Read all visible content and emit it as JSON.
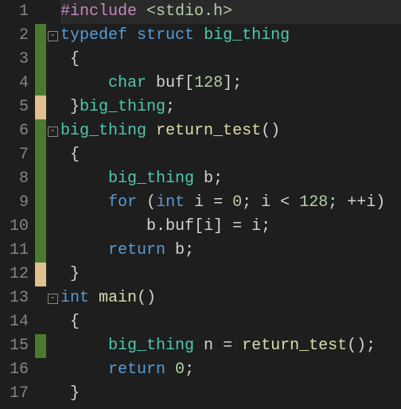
{
  "editor": {
    "lines": [
      {
        "num": "1",
        "marker": "none",
        "fold": "",
        "tokens": [
          [
            "pp",
            "#include "
          ],
          [
            "ang",
            "<stdio.h>"
          ]
        ],
        "current": true
      },
      {
        "num": "2",
        "marker": "green",
        "fold": "box",
        "tokens": [
          [
            "kw",
            "typedef"
          ],
          [
            "id",
            " "
          ],
          [
            "kw",
            "struct"
          ],
          [
            "id",
            " "
          ],
          [
            "ty",
            "big_thing"
          ]
        ]
      },
      {
        "num": "3",
        "marker": "green",
        "fold": "",
        "tokens": [
          [
            "pn",
            " {"
          ]
        ]
      },
      {
        "num": "4",
        "marker": "green",
        "fold": "",
        "tokens": [
          [
            "id",
            "     "
          ],
          [
            "ty",
            "char"
          ],
          [
            "id",
            " buf"
          ],
          [
            "pn",
            "["
          ],
          [
            "num",
            "128"
          ],
          [
            "pn",
            "];"
          ]
        ]
      },
      {
        "num": "5",
        "marker": "yellow",
        "fold": "",
        "tokens": [
          [
            "pn",
            " }"
          ],
          [
            "ty",
            "big_thing"
          ],
          [
            "pn",
            ";"
          ]
        ]
      },
      {
        "num": "6",
        "marker": "green",
        "fold": "box",
        "tokens": [
          [
            "ty",
            "big_thing"
          ],
          [
            "id",
            " "
          ],
          [
            "fn",
            "return_test"
          ],
          [
            "pn",
            "()"
          ]
        ]
      },
      {
        "num": "7",
        "marker": "green",
        "fold": "",
        "tokens": [
          [
            "pn",
            " {"
          ]
        ]
      },
      {
        "num": "8",
        "marker": "green",
        "fold": "",
        "tokens": [
          [
            "id",
            "     "
          ],
          [
            "ty",
            "big_thing"
          ],
          [
            "id",
            " b"
          ],
          [
            "pn",
            ";"
          ]
        ]
      },
      {
        "num": "9",
        "marker": "green",
        "fold": "",
        "tokens": [
          [
            "id",
            "     "
          ],
          [
            "kw",
            "for"
          ],
          [
            "id",
            " "
          ],
          [
            "pn",
            "("
          ],
          [
            "kw",
            "int"
          ],
          [
            "id",
            " i "
          ],
          [
            "op",
            "="
          ],
          [
            "id",
            " "
          ],
          [
            "num",
            "0"
          ],
          [
            "pn",
            ";"
          ],
          [
            "id",
            " i "
          ],
          [
            "op",
            "<"
          ],
          [
            "id",
            " "
          ],
          [
            "num",
            "128"
          ],
          [
            "pn",
            ";"
          ],
          [
            "id",
            " "
          ],
          [
            "op",
            "++"
          ],
          [
            "id",
            "i"
          ],
          [
            "pn",
            ")"
          ]
        ]
      },
      {
        "num": "10",
        "marker": "green",
        "fold": "",
        "tokens": [
          [
            "id",
            "         b"
          ],
          [
            "pn",
            "."
          ],
          [
            "id",
            "buf"
          ],
          [
            "pn",
            "["
          ],
          [
            "id",
            "i"
          ],
          [
            "pn",
            "]"
          ],
          [
            "id",
            " "
          ],
          [
            "op",
            "="
          ],
          [
            "id",
            " i"
          ],
          [
            "pn",
            ";"
          ]
        ]
      },
      {
        "num": "11",
        "marker": "green",
        "fold": "",
        "tokens": [
          [
            "id",
            "     "
          ],
          [
            "kw",
            "return"
          ],
          [
            "id",
            " b"
          ],
          [
            "pn",
            ";"
          ]
        ]
      },
      {
        "num": "12",
        "marker": "yellow",
        "fold": "",
        "tokens": [
          [
            "pn",
            " }"
          ]
        ]
      },
      {
        "num": "13",
        "marker": "none",
        "fold": "box",
        "tokens": [
          [
            "kw",
            "int"
          ],
          [
            "id",
            " "
          ],
          [
            "fn",
            "main"
          ],
          [
            "pn",
            "()"
          ]
        ]
      },
      {
        "num": "14",
        "marker": "none",
        "fold": "",
        "tokens": [
          [
            "pn",
            " {"
          ]
        ]
      },
      {
        "num": "15",
        "marker": "green",
        "fold": "",
        "tokens": [
          [
            "id",
            "     "
          ],
          [
            "ty",
            "big_thing"
          ],
          [
            "id",
            " n "
          ],
          [
            "op",
            "="
          ],
          [
            "id",
            " "
          ],
          [
            "fn",
            "return_test"
          ],
          [
            "pn",
            "();"
          ]
        ]
      },
      {
        "num": "16",
        "marker": "none",
        "fold": "",
        "tokens": [
          [
            "id",
            "     "
          ],
          [
            "kw",
            "return"
          ],
          [
            "id",
            " "
          ],
          [
            "num",
            "0"
          ],
          [
            "pn",
            ";"
          ]
        ]
      },
      {
        "num": "17",
        "marker": "none",
        "fold": "",
        "tokens": [
          [
            "pn",
            " }"
          ]
        ]
      }
    ],
    "fold_glyph": "-"
  }
}
